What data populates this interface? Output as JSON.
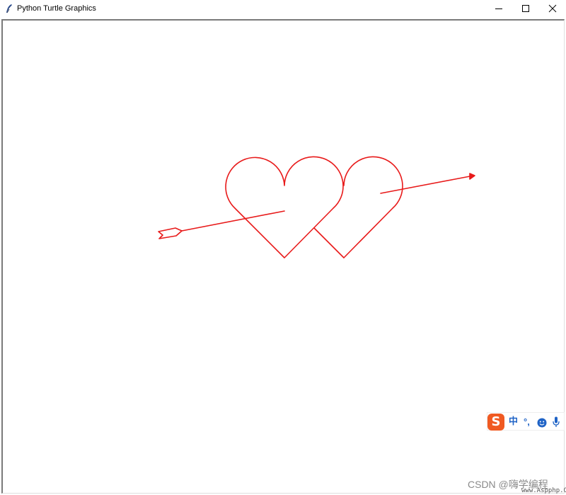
{
  "window": {
    "title": "Python Turtle Graphics",
    "controls": {
      "minimize": "minimize-icon",
      "maximize": "maximize-icon",
      "close": "close-icon"
    }
  },
  "drawing": {
    "pen_color": "#e81a1a",
    "shapes": [
      "heart",
      "heart",
      "arrow"
    ]
  },
  "ime": {
    "logo": "S",
    "mode": "中",
    "punct": "°,",
    "icons": [
      "emoji-icon",
      "microphone-icon"
    ]
  },
  "watermark": {
    "text": "CSDN @嗨学编程",
    "domain": "www.Aspphp.Online"
  }
}
